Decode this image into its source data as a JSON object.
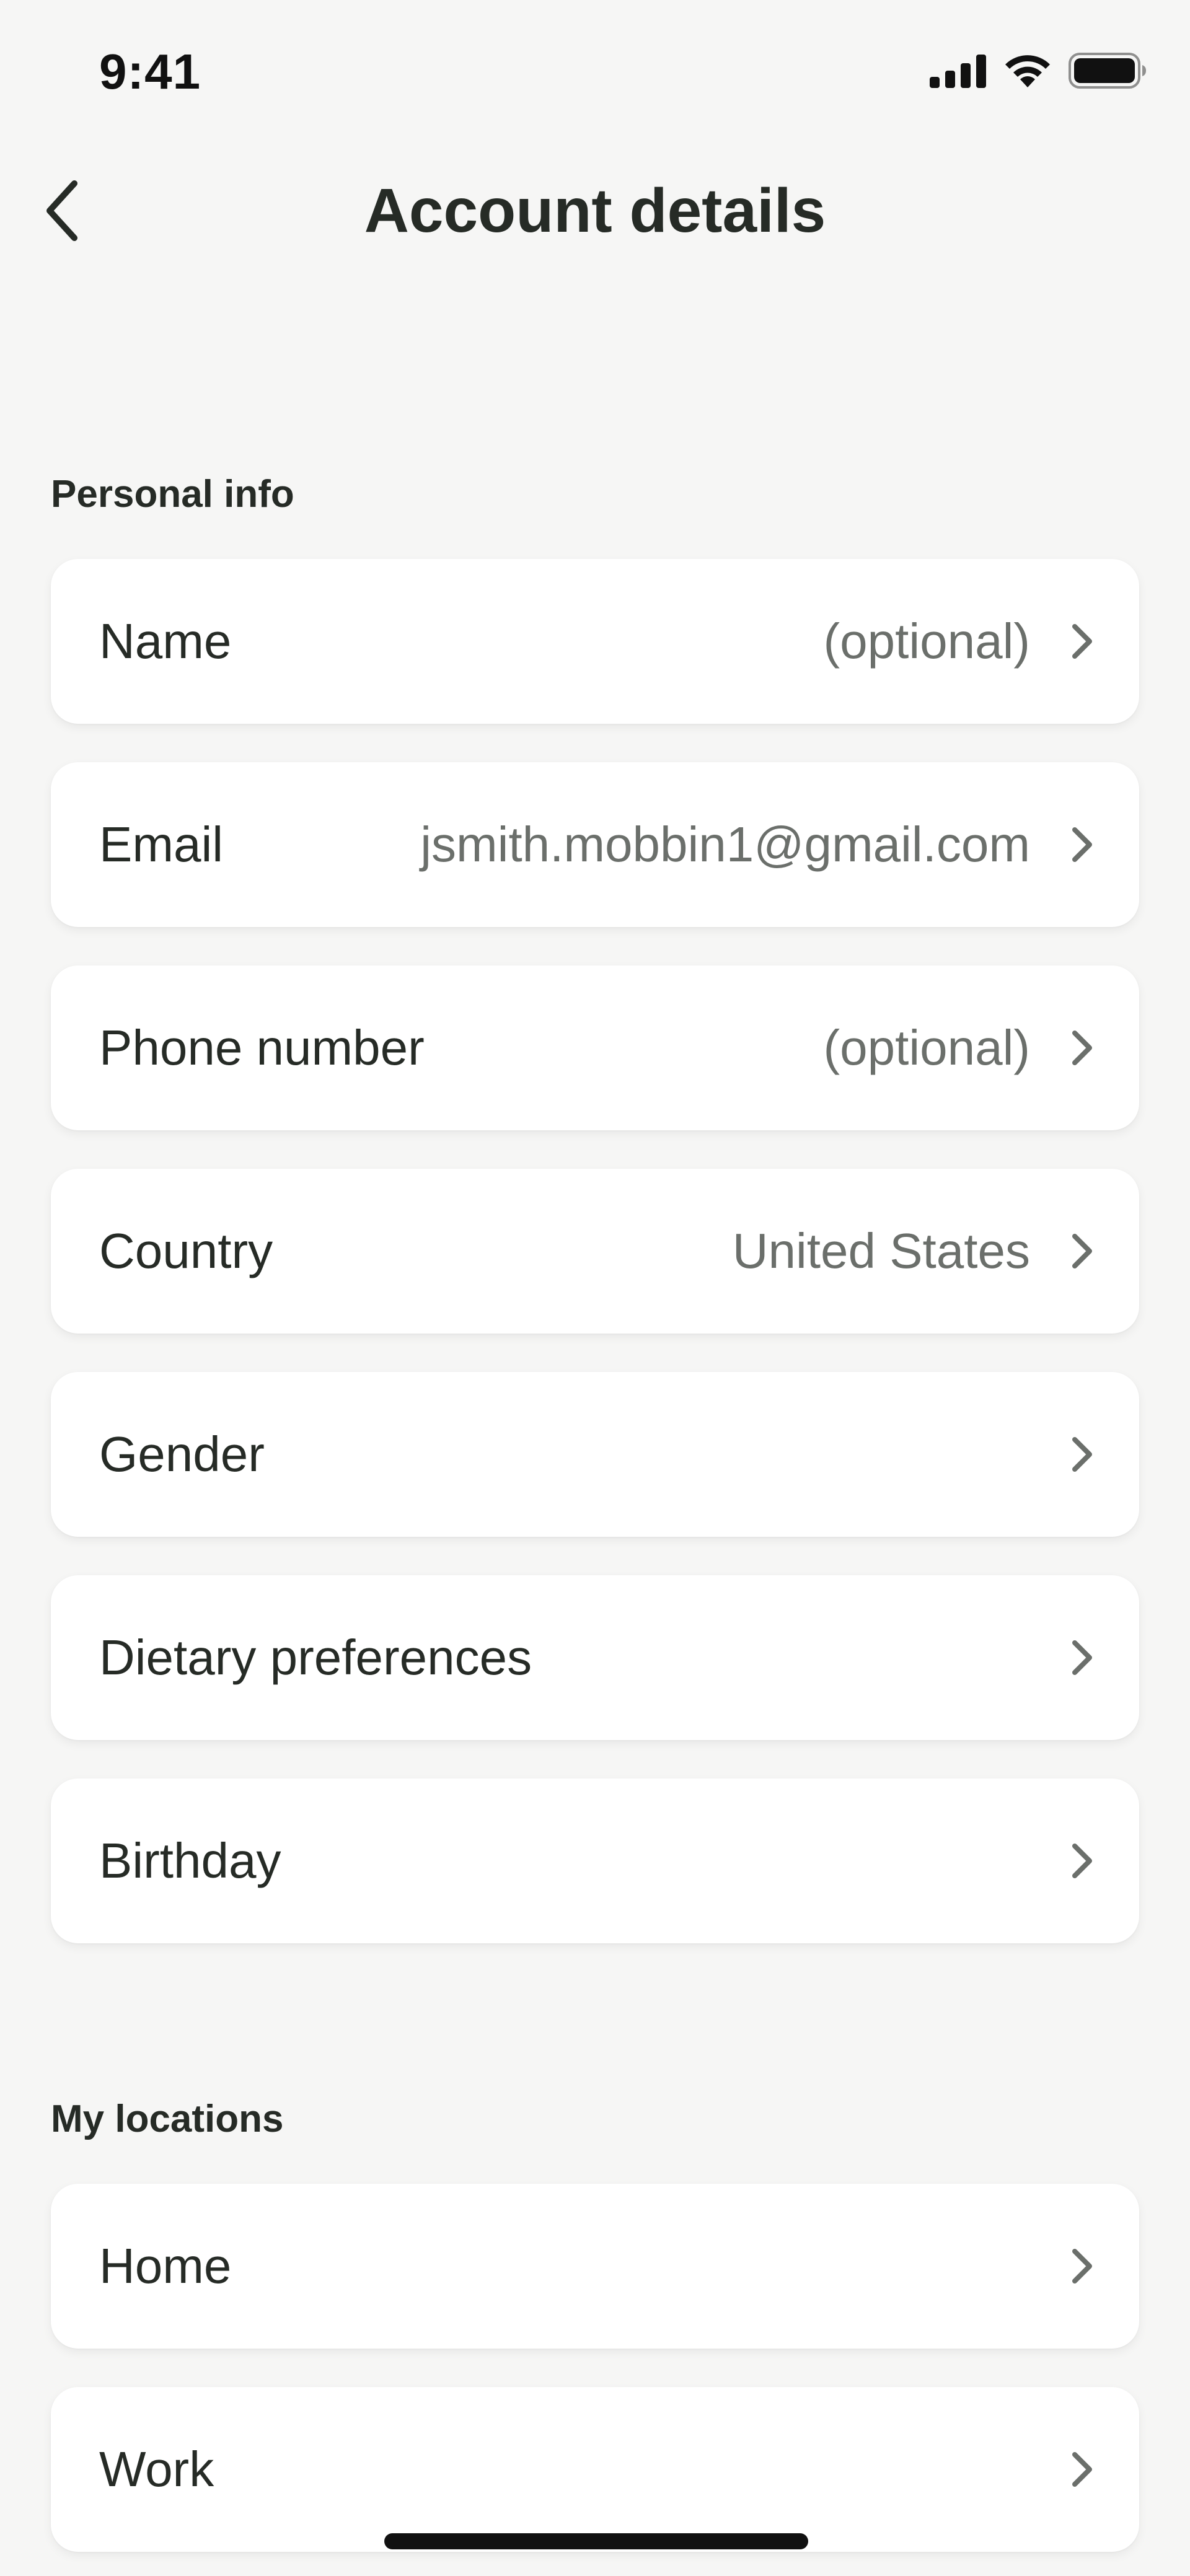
{
  "status_bar": {
    "time": "9:41",
    "icons": [
      "cellular-signal-icon",
      "wifi-icon",
      "battery-icon"
    ]
  },
  "nav": {
    "title": "Account details",
    "back_icon": "chevron-left-icon"
  },
  "sections": {
    "personal": {
      "label": "Personal info",
      "rows": [
        {
          "label": "Name",
          "value": "(optional)"
        },
        {
          "label": "Email",
          "value": "jsmith.mobbin1@gmail.com"
        },
        {
          "label": "Phone number",
          "value": "(optional)"
        },
        {
          "label": "Country",
          "value": "United States"
        },
        {
          "label": "Gender",
          "value": ""
        },
        {
          "label": "Dietary preferences",
          "value": ""
        },
        {
          "label": "Birthday",
          "value": ""
        }
      ]
    },
    "locations": {
      "label": "My locations",
      "rows": [
        {
          "label": "Home",
          "value": ""
        },
        {
          "label": "Work",
          "value": ""
        }
      ]
    }
  },
  "colors": {
    "background": "#f6f6f5",
    "card": "#ffffff",
    "text_primary": "#262b26",
    "text_secondary": "#6b6f6b",
    "chevron": "#6b6f6b"
  }
}
